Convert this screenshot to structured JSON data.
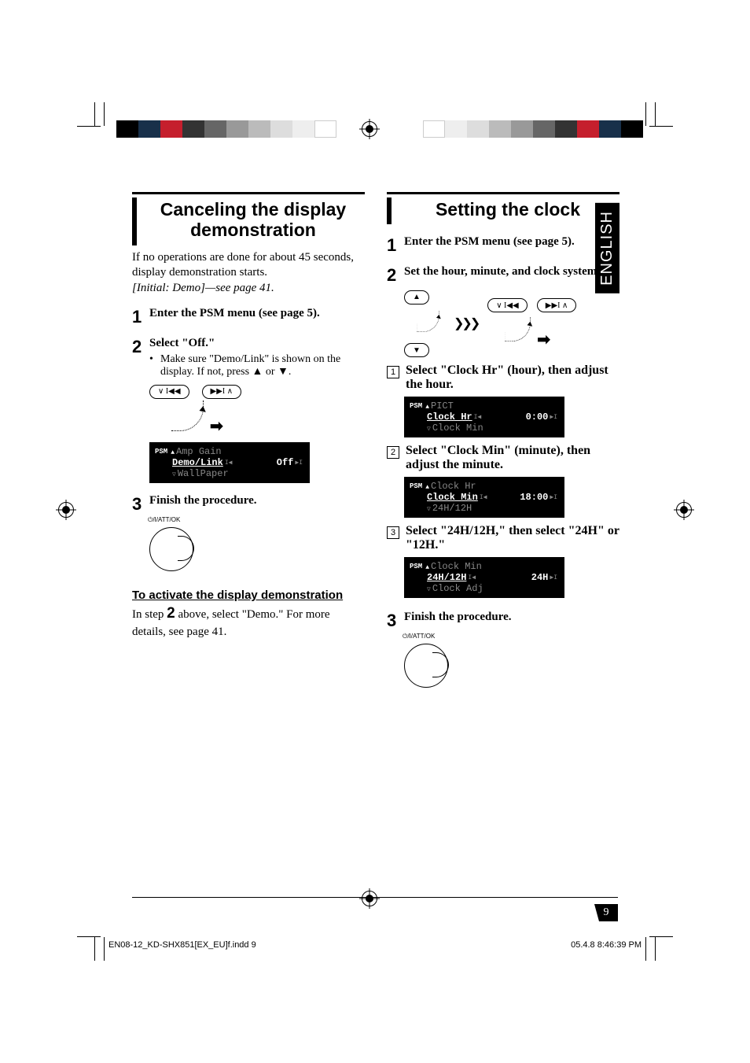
{
  "language_tab": "ENGLISH",
  "page_number": "9",
  "footer": {
    "file_ref": "EN08-12_KD-SHX851[EX_EU]f.indd   9",
    "timestamp": "05.4.8   8:46:39 PM"
  },
  "left_column": {
    "heading": "Canceling the display demonstration",
    "intro_line1": "If no operations are done for about 45 seconds, display demonstration starts.",
    "intro_italic": "[Initial: Demo]—see page 41.",
    "steps": {
      "s1": "Enter the PSM menu (see page 5).",
      "s2": "Select \"Off.\"",
      "s2_bullet": "Make sure \"Demo/Link\" is shown on the display. If not, press ▲ or ▼.",
      "s3": "Finish the procedure."
    },
    "lcd": {
      "psm_label": "PSM",
      "line_top": "Amp Gain",
      "line_mid": "Demo/Link",
      "value": "Off",
      "line_bot": "WallPaper"
    },
    "dial_label": "/I/ATT/OK",
    "subhead": "To activate the display demonstration",
    "subtext_a": "In step ",
    "subtext_num": "2",
    "subtext_b": " above, select \"Demo.\" For more details, see page 41."
  },
  "right_column": {
    "heading": "Setting the clock",
    "steps": {
      "s1": "Enter the PSM menu (see page 5).",
      "s2": "Set the hour, minute, and clock system.",
      "sub1": "Select \"Clock Hr\" (hour), then adjust the hour.",
      "sub2": "Select \"Clock Min\" (minute), then adjust the minute.",
      "sub3": "Select \"24H/12H,\" then select \"24H\" or \"12H.\"",
      "s3": "Finish the procedure."
    },
    "lcd1": {
      "psm_label": "PSM",
      "line_top": "PICT",
      "line_mid": "Clock Hr",
      "value": "0:00",
      "line_bot": "Clock Min"
    },
    "lcd2": {
      "psm_label": "PSM",
      "line_top": "Clock Hr",
      "line_mid": "Clock Min",
      "value": "18:00",
      "line_bot": "24H/12H"
    },
    "lcd3": {
      "psm_label": "PSM",
      "line_top": "Clock Min",
      "line_mid": "24H/12H",
      "value": "24H",
      "line_bot": "Clock Adj"
    },
    "dial_label": "/I/ATT/OK"
  },
  "buttons": {
    "up": "▲",
    "down": "▼",
    "prev": "∨ I◀◀",
    "next": "▶▶I ∧"
  }
}
